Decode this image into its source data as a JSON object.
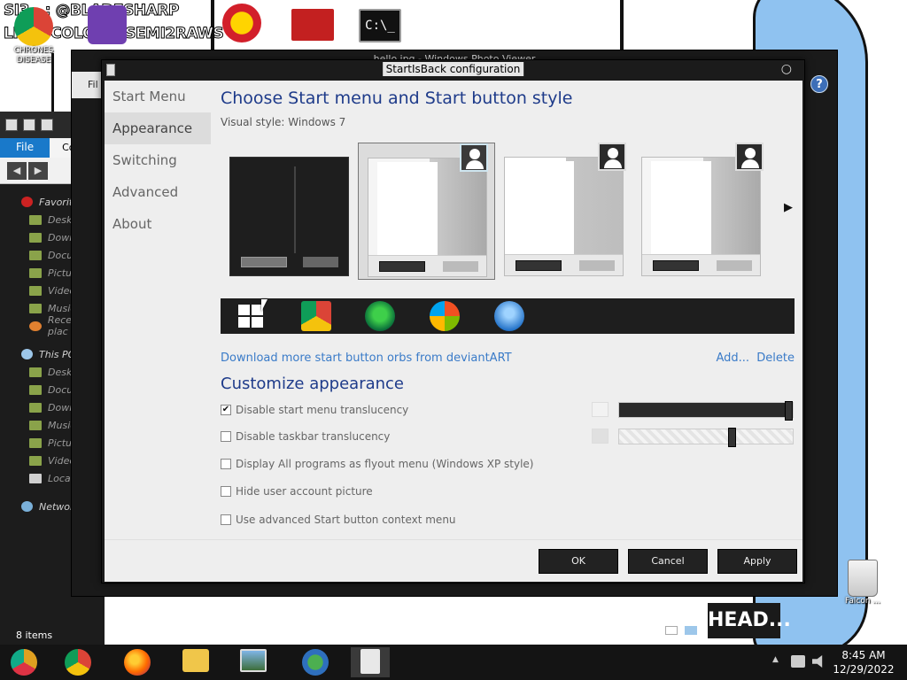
{
  "colors": {
    "dialog_bg": "#eeeeee",
    "heading": "#1e3b8a",
    "link": "#3a7bc8",
    "dark_chrome": "#1b1b1b"
  },
  "desktop": {
    "overlay_top": "SI3...: @BLADESHARP",
    "overlay_bottom": "LIN... COLOR @SEMI2RAWS",
    "icons": [
      {
        "name": "chrome-icon",
        "label": "CHRONES DISEASE"
      },
      {
        "name": "visual-studio-icon",
        "label": ""
      },
      {
        "name": "p-logo-icon",
        "label": ""
      },
      {
        "name": "flag-icon",
        "label": ""
      },
      {
        "name": "cmd-icon",
        "label": "C:\\_"
      }
    ],
    "trash_label": "Falcon ...",
    "head_badge": "HEAD..."
  },
  "explorer": {
    "tab_file": "File",
    "tab_computer": "Comput",
    "nav": {
      "back": "◀",
      "forward": "▶",
      "up": "↑"
    },
    "favorites_header": "Favorites",
    "favorites": [
      "Desktop",
      "Downloads",
      "Documents",
      "Pictures",
      "Videos",
      "Music",
      "Recent plac"
    ],
    "this_pc_header": "This PC",
    "this_pc": [
      "Desktop",
      "Documents",
      "Downloads",
      "Music",
      "Pictures",
      "Videos",
      "Local Disk ("
    ],
    "network": "Network",
    "status": "8 items"
  },
  "viewer": {
    "title": "hello.jpg - Windows Photo Viewer",
    "left_tab": "Fil",
    "help_icon": "?"
  },
  "dialog": {
    "title": "StartIsBack configuration",
    "close_glyph": "○",
    "sidebar": [
      {
        "label": "Start Menu",
        "active": false
      },
      {
        "label": "Appearance",
        "active": true
      },
      {
        "label": "Switching",
        "active": false
      },
      {
        "label": "Advanced",
        "active": false
      },
      {
        "label": "About",
        "active": false
      }
    ],
    "heading": "Choose Start menu and Start button style",
    "visual_style_label": "Visual style:  Windows 7",
    "next_arrow": "▶",
    "orbs": [
      "windows-10-orb-icon",
      "chrome-orb-icon",
      "clover-orb-icon",
      "windows-7-orb-icon",
      "windows-vista-orb-icon"
    ],
    "download_link": "Download more start button orbs from deviantART",
    "add_link": "Add...",
    "delete_link": "Delete",
    "customize_heading": "Customize appearance",
    "options": [
      {
        "label": "Disable start menu translucency",
        "checked": true
      },
      {
        "label": "Disable taskbar translucency",
        "checked": false
      },
      {
        "label": "Display All programs as flyout menu (Windows XP style)",
        "checked": false
      },
      {
        "label": "Hide user account picture",
        "checked": false
      },
      {
        "label": "Use advanced Start button context menu",
        "checked": false
      }
    ],
    "check_glyph": "✔",
    "start_menu_opacity": 1.0,
    "taskbar_opacity": 0.66,
    "buttons": {
      "ok": "OK",
      "cancel": "Cancel",
      "apply": "Apply"
    }
  },
  "taskbar": {
    "apps": [
      "chrome-canary-icon",
      "chrome-icon",
      "firefox-icon",
      "file-explorer-icon",
      "photo-viewer-icon",
      "network-people-icon",
      "startisback-icon"
    ],
    "tray_up": "▲",
    "time": "8:45 AM",
    "date": "12/29/2022"
  }
}
